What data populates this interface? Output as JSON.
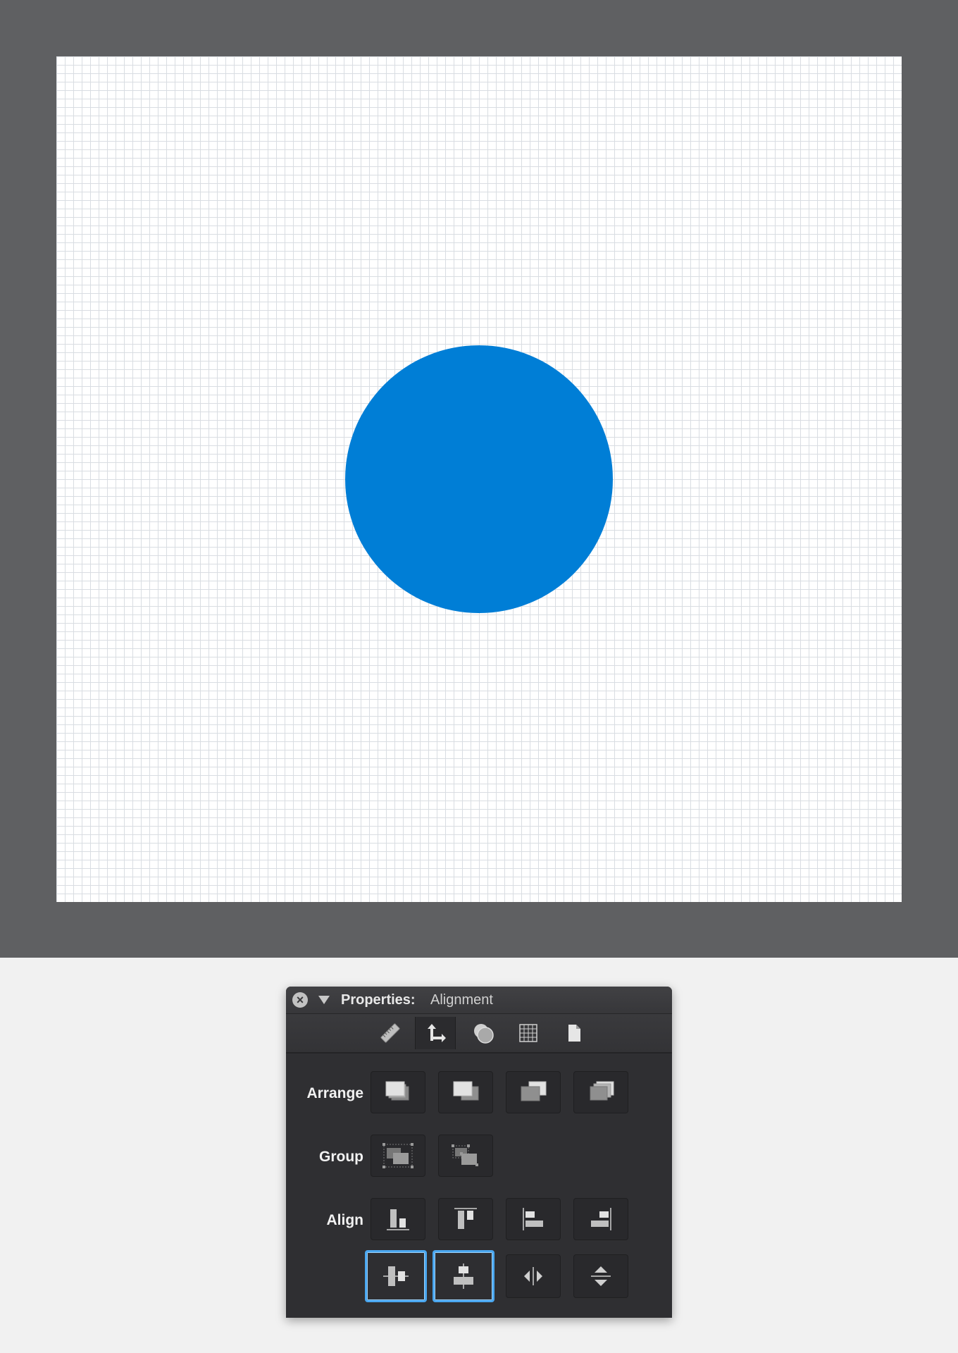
{
  "canvas": {
    "shape_color": "#007ed6",
    "frame_color": "#5f6062",
    "artboard_color": "#ffffff"
  },
  "panel": {
    "close_glyph": "×",
    "title_label": "Properties:",
    "title_value": "Alignment",
    "toolbar": {
      "tools": [
        "ruler-icon",
        "arrange-align-icon",
        "appearance-icon",
        "grid-icon",
        "document-icon"
      ],
      "active_tool": "arrange-align-icon"
    },
    "rows": {
      "arrange_label": "Arrange",
      "group_label": "Group",
      "align_label": "Align"
    },
    "buttons": {
      "arrange": [
        "bring-to-front-icon",
        "bring-forward-icon",
        "send-backward-icon",
        "send-to-back-icon"
      ],
      "group": [
        "group-icon",
        "ungroup-icon"
      ],
      "align_row1": [
        "align-bottom-icon",
        "align-top-icon",
        "align-left-icon",
        "align-right-icon"
      ],
      "align_row2": [
        "align-horizontal-center-icon",
        "align-vertical-center-icon",
        "distribute-horizontal-icon",
        "distribute-vertical-icon"
      ],
      "selected": [
        "align-horizontal-center-icon",
        "align-vertical-center-icon"
      ]
    }
  }
}
